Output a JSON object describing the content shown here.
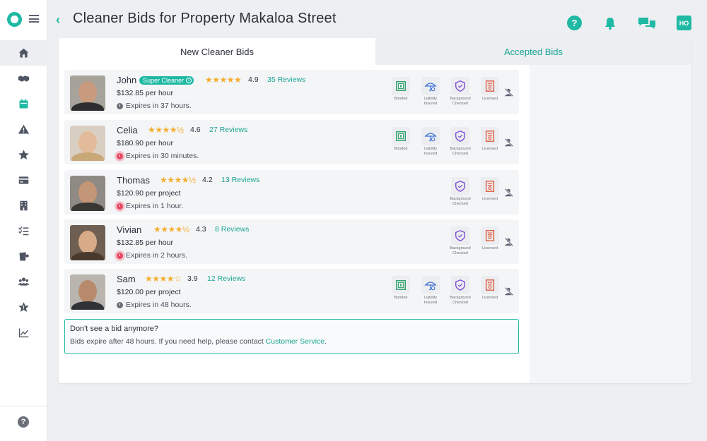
{
  "header": {
    "title": "Cleaner Bids for Property Makaloa Street",
    "user_initials": "HO",
    "help_glyph": "?"
  },
  "sidebar": {
    "items": [
      {
        "icon": "home-icon",
        "active": true
      },
      {
        "icon": "handshake-icon",
        "active": false
      },
      {
        "icon": "calendar-icon",
        "active": false
      },
      {
        "icon": "alert-icon",
        "active": false
      },
      {
        "icon": "star-icon",
        "active": false
      },
      {
        "icon": "credit-card-icon",
        "active": false
      },
      {
        "icon": "building-icon",
        "active": false
      },
      {
        "icon": "checklist-icon",
        "active": false
      },
      {
        "icon": "supplies-icon",
        "active": false
      },
      {
        "icon": "team-icon",
        "active": false
      },
      {
        "icon": "star-badge-icon",
        "active": false
      },
      {
        "icon": "chart-icon",
        "active": false
      }
    ],
    "help_glyph": "?"
  },
  "tabs": {
    "new_label": "New Cleaner Bids",
    "accepted_label": "Accepted Bids"
  },
  "credential_labels": {
    "bonded": "Bonded",
    "liability": "Liability\nInsured",
    "background": "Background\nChecked",
    "licensed": "Licensed"
  },
  "bids": [
    {
      "name": "John",
      "badge": "Super Cleaner",
      "stars": "★★★★★",
      "rating": "4.9",
      "reviews": "35 Reviews",
      "price": "$132.85 per hour",
      "expires": "Expires in 37 hours.",
      "urgent": false
    },
    {
      "name": "Celia",
      "stars": "★★★★½",
      "rating": "4.6",
      "reviews": "27 Reviews",
      "price": "$180.90 per hour",
      "expires": "Expires in 30 minutes.",
      "urgent": true
    },
    {
      "name": "Thomas",
      "stars": "★★★★½",
      "rating": "4.2",
      "reviews": "13 Reviews",
      "price": "$120.90 per project",
      "expires": "Expires in 1 hour.",
      "urgent": true
    },
    {
      "name": "Vivian",
      "stars": "★★★★½",
      "rating": "4.3",
      "reviews": "8 Reviews",
      "price": "$132.85 per hour",
      "expires": "Expires in 2 hours.",
      "urgent": true
    },
    {
      "name": "Sam",
      "stars": "★★★★☆",
      "rating": "3.9",
      "reviews": "12 Reviews",
      "price": "$120.00 per project",
      "expires": "Expires in 48 hours.",
      "urgent": false
    }
  ],
  "notice": {
    "title": "Don't see a bid anymore?",
    "text": "Bids expire after 48 hours. If you need help, please contact ",
    "link": "Customer Service",
    "end": "."
  },
  "colors": {
    "accent": "#1fb9a4",
    "urgent": "#e8465f",
    "star": "#f3ae2f"
  }
}
